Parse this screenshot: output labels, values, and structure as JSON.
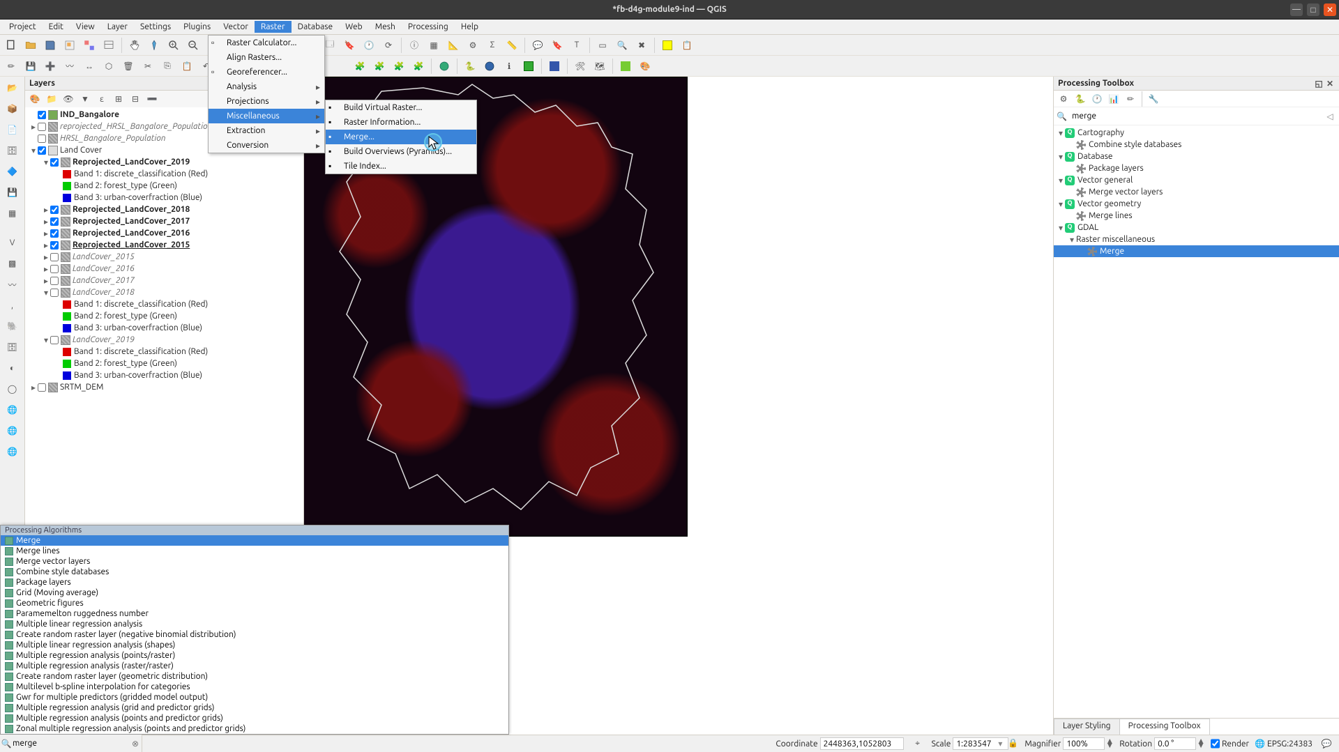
{
  "window": {
    "title": "*fb-d4g-module9-ind — QGIS"
  },
  "menubar": [
    "Project",
    "Edit",
    "View",
    "Layer",
    "Settings",
    "Plugins",
    "Vector",
    "Raster",
    "Database",
    "Web",
    "Mesh",
    "Processing",
    "Help"
  ],
  "menubar_open_index": 7,
  "raster_menu": {
    "items": [
      {
        "label": "Raster Calculator...",
        "icon": "calc"
      },
      {
        "label": "Align Rasters...",
        "icon": ""
      },
      {
        "label": "Georeferencer...",
        "icon": "grid"
      },
      {
        "label": "Analysis",
        "submenu": true
      },
      {
        "label": "Projections",
        "submenu": true
      },
      {
        "label": "Miscellaneous",
        "submenu": true,
        "highlight": true
      },
      {
        "label": "Extraction",
        "submenu": true
      },
      {
        "label": "Conversion",
        "submenu": true
      }
    ]
  },
  "misc_submenu": {
    "items": [
      {
        "label": "Build Virtual Raster...",
        "icon": "bvr"
      },
      {
        "label": "Raster Information...",
        "icon": "info"
      },
      {
        "label": "Merge...",
        "icon": "merge",
        "highlight": true
      },
      {
        "label": "Build Overviews (Pyramids)...",
        "icon": "pyr"
      },
      {
        "label": "Tile Index...",
        "icon": "tile"
      }
    ]
  },
  "layers_panel": {
    "title": "Layers",
    "tree": [
      {
        "d": 0,
        "chk": true,
        "lbl": "IND_Bangalore",
        "bold": true,
        "ric": "poly"
      },
      {
        "d": 0,
        "tw": "▸",
        "chk": false,
        "lbl": "reprojected_HRSL_Bangalore_Population",
        "italic": true,
        "ric": "ras"
      },
      {
        "d": 0,
        "chk": false,
        "lbl": "HRSL_Bangalore_Population",
        "italic": true,
        "ric": "ras"
      },
      {
        "d": 0,
        "tw": "▾",
        "chk": true,
        "lbl": "Land Cover",
        "ric": "grp"
      },
      {
        "d": 1,
        "tw": "▾",
        "chk": true,
        "lbl": "Reprojected_LandCover_2019",
        "bold": true,
        "ric": "ras"
      },
      {
        "d": 2,
        "chip": "#d00",
        "lbl": "Band 1: discrete_classification (Red)"
      },
      {
        "d": 2,
        "chip": "#0c0",
        "lbl": "Band 2: forest_type (Green)"
      },
      {
        "d": 2,
        "chip": "#00d",
        "lbl": "Band 3: urban-coverfraction (Blue)"
      },
      {
        "d": 1,
        "tw": "▸",
        "chk": true,
        "lbl": "Reprojected_LandCover_2018",
        "bold": true,
        "ric": "ras"
      },
      {
        "d": 1,
        "tw": "▸",
        "chk": true,
        "lbl": "Reprojected_LandCover_2017",
        "bold": true,
        "ric": "ras"
      },
      {
        "d": 1,
        "tw": "▸",
        "chk": true,
        "lbl": "Reprojected_LandCover_2016",
        "bold": true,
        "ric": "ras"
      },
      {
        "d": 1,
        "tw": "▸",
        "chk": true,
        "lbl": "Reprojected_LandCover_2015",
        "bold": true,
        "under": true,
        "ric": "ras"
      },
      {
        "d": 1,
        "tw": "▸",
        "chk": false,
        "lbl": "LandCover_2015",
        "italic": true,
        "ric": "ras"
      },
      {
        "d": 1,
        "tw": "▸",
        "chk": false,
        "lbl": "LandCover_2016",
        "italic": true,
        "ric": "ras"
      },
      {
        "d": 1,
        "tw": "▸",
        "chk": false,
        "lbl": "LandCover_2017",
        "italic": true,
        "ric": "ras"
      },
      {
        "d": 1,
        "tw": "▾",
        "chk": false,
        "lbl": "LandCover_2018",
        "italic": true,
        "ric": "ras"
      },
      {
        "d": 2,
        "chip": "#d00",
        "lbl": "Band 1: discrete_classification (Red)"
      },
      {
        "d": 2,
        "chip": "#0c0",
        "lbl": "Band 2: forest_type (Green)"
      },
      {
        "d": 2,
        "chip": "#00d",
        "lbl": "Band 3: urban-coverfraction (Blue)"
      },
      {
        "d": 1,
        "tw": "▾",
        "chk": false,
        "lbl": "LandCover_2019",
        "italic": true,
        "ric": "ras"
      },
      {
        "d": 2,
        "chip": "#d00",
        "lbl": "Band 1: discrete_classification (Red)"
      },
      {
        "d": 2,
        "chip": "#0c0",
        "lbl": "Band 2: forest_type (Green)"
      },
      {
        "d": 2,
        "chip": "#00d",
        "lbl": "Band 3: urban-coverfraction (Blue)"
      },
      {
        "d": 0,
        "tw": "▸",
        "chk": false,
        "lbl": "SRTM_DEM",
        "ric": "ras"
      }
    ]
  },
  "locator": {
    "header": "Processing Algorithms",
    "value": "merge",
    "items": [
      "Merge",
      "Merge lines",
      "Merge vector layers",
      "Combine style databases",
      "Package layers",
      "Grid (Moving average)",
      "Geometric figures",
      "Paramemelton ruggedness number",
      "Multiple linear regression analysis",
      "Create random raster layer (negative binomial distribution)",
      "Multiple linear regression analysis (shapes)",
      "Multiple regression analysis (points/raster)",
      "Multiple regression analysis (raster/raster)",
      "Create random raster layer (geometric distribution)",
      "Multilevel b-spline interpolation for categories",
      "Gwr for multiple predictors (gridded model output)",
      "Multiple regression analysis (grid and predictor grids)",
      "Multiple regression analysis (points and predictor grids)",
      "Zonal multiple regression analysis (points and predictor grids)"
    ]
  },
  "toolbox": {
    "title": "Processing Toolbox",
    "search": "merge",
    "groups": [
      {
        "name": "Cartography",
        "open": true,
        "items": [
          "Combine style databases"
        ]
      },
      {
        "name": "Database",
        "open": true,
        "items": [
          "Package layers"
        ]
      },
      {
        "name": "Vector general",
        "open": true,
        "items": [
          "Merge vector layers"
        ]
      },
      {
        "name": "Vector geometry",
        "open": true,
        "items": [
          "Merge lines"
        ]
      },
      {
        "name": "GDAL",
        "open": true,
        "sub": [
          {
            "name": "Raster miscellaneous",
            "items": [
              "Merge"
            ],
            "sel": "Merge"
          }
        ]
      }
    ],
    "tabs": [
      "Layer Styling",
      "Processing Toolbox"
    ],
    "active_tab": 1
  },
  "status": {
    "coord_label": "Coordinate",
    "coord": "2448363,1052803",
    "scale_label": "Scale",
    "scale": "1:283547",
    "mag_label": "Magnifier",
    "mag": "100%",
    "rot_label": "Rotation",
    "rot": "0.0 °",
    "render": "Render",
    "crs": "EPSG:24383"
  }
}
